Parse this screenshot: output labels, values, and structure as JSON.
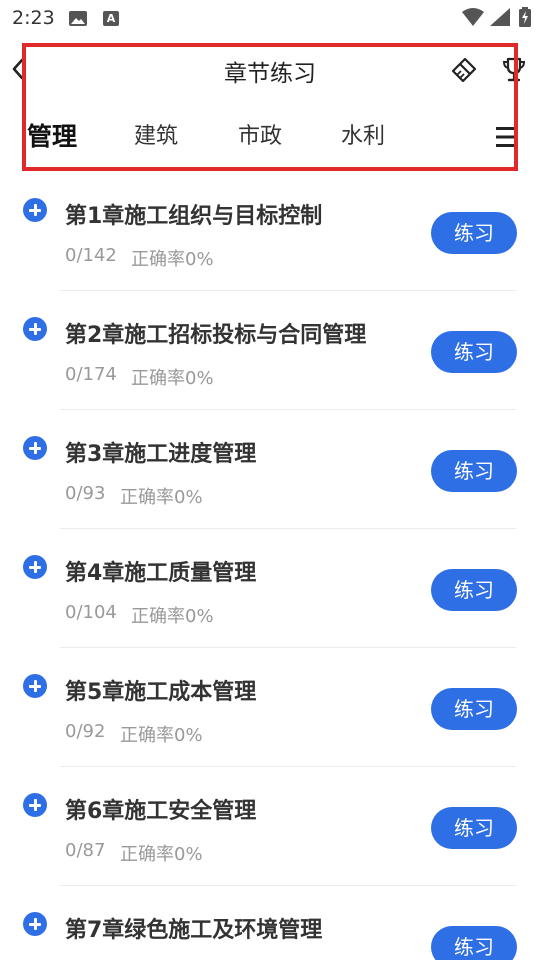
{
  "status_bar": {
    "time": "2:23",
    "icons": [
      "image-icon",
      "font-a-icon",
      "wifi-icon",
      "signal-icon",
      "battery-icon"
    ]
  },
  "header": {
    "title": "章节练习",
    "back_icon": "chevron-left-icon",
    "right_icons": [
      "eraser-icon",
      "trophy-icon"
    ]
  },
  "tabs": {
    "items": [
      {
        "label": "管理",
        "active": true
      },
      {
        "label": "建筑",
        "active": false
      },
      {
        "label": "市政",
        "active": false
      },
      {
        "label": "水利",
        "active": false
      }
    ],
    "menu_icon": "menu-icon"
  },
  "colors": {
    "accent": "#2f6fe6",
    "highlight_box": "#e02a2a",
    "text_primary": "#333333",
    "text_secondary": "#999999"
  },
  "chapters": [
    {
      "title": "第1章施工组织与目标控制",
      "progress": "0/142",
      "accuracy": "正确率0%",
      "button": "练习"
    },
    {
      "title": "第2章施工招标投标与合同管理",
      "progress": "0/174",
      "accuracy": "正确率0%",
      "button": "练习"
    },
    {
      "title": "第3章施工进度管理",
      "progress": "0/93",
      "accuracy": "正确率0%",
      "button": "练习"
    },
    {
      "title": "第4章施工质量管理",
      "progress": "0/104",
      "accuracy": "正确率0%",
      "button": "练习"
    },
    {
      "title": "第5章施工成本管理",
      "progress": "0/92",
      "accuracy": "正确率0%",
      "button": "练习"
    },
    {
      "title": "第6章施工安全管理",
      "progress": "0/87",
      "accuracy": "正确率0%",
      "button": "练习"
    },
    {
      "title": "第7章绿色施工及环境管理",
      "progress": "",
      "accuracy": "",
      "button": "练习"
    }
  ]
}
